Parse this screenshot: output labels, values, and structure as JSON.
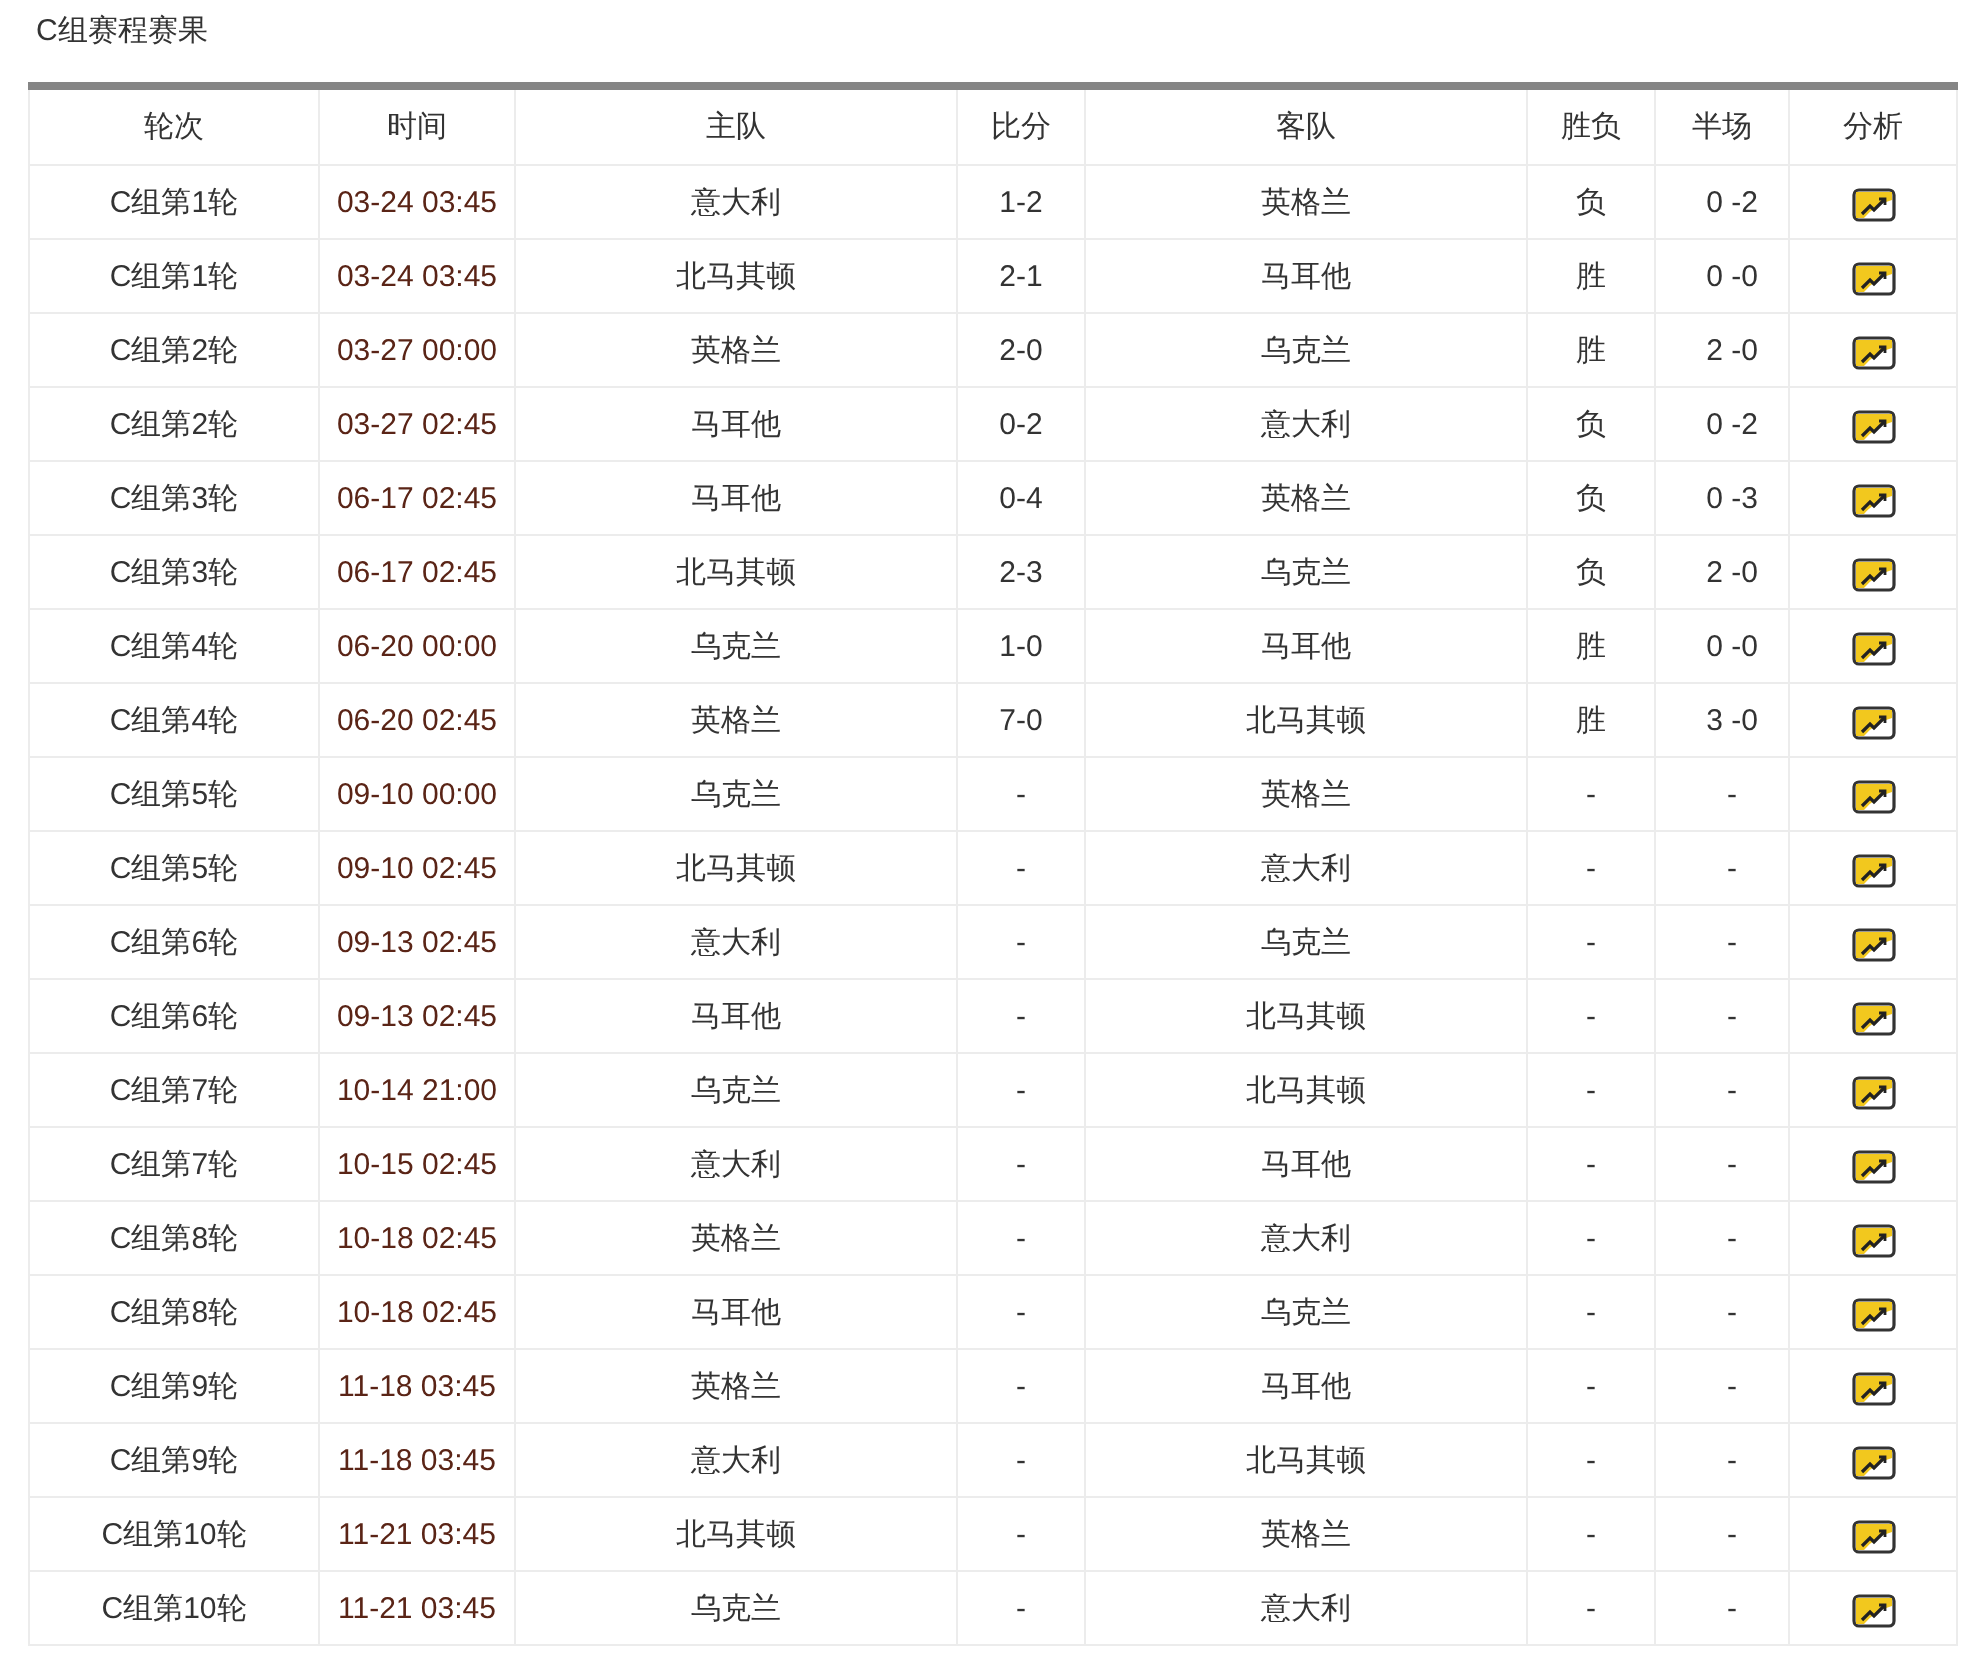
{
  "title": "C组赛程赛果",
  "table": {
    "columns": [
      "轮次",
      "时间",
      "主队",
      "比分",
      "客队",
      "胜负",
      "半场",
      "分析"
    ],
    "rows": [
      {
        "round": "C组第1轮",
        "time": "03-24 03:45",
        "home": "意大利",
        "score": "1-2",
        "away": "英格兰",
        "result": "负",
        "half": "0 -2"
      },
      {
        "round": "C组第1轮",
        "time": "03-24 03:45",
        "home": "北马其顿",
        "score": "2-1",
        "away": "马耳他",
        "result": "胜",
        "half": "0 -0"
      },
      {
        "round": "C组第2轮",
        "time": "03-27 00:00",
        "home": "英格兰",
        "score": "2-0",
        "away": "乌克兰",
        "result": "胜",
        "half": "2 -0"
      },
      {
        "round": "C组第2轮",
        "time": "03-27 02:45",
        "home": "马耳他",
        "score": "0-2",
        "away": "意大利",
        "result": "负",
        "half": "0 -2"
      },
      {
        "round": "C组第3轮",
        "time": "06-17 02:45",
        "home": "马耳他",
        "score": "0-4",
        "away": "英格兰",
        "result": "负",
        "half": "0 -3"
      },
      {
        "round": "C组第3轮",
        "time": "06-17 02:45",
        "home": "北马其顿",
        "score": "2-3",
        "away": "乌克兰",
        "result": "负",
        "half": "2 -0"
      },
      {
        "round": "C组第4轮",
        "time": "06-20 00:00",
        "home": "乌克兰",
        "score": "1-0",
        "away": "马耳他",
        "result": "胜",
        "half": "0 -0"
      },
      {
        "round": "C组第4轮",
        "time": "06-20 02:45",
        "home": "英格兰",
        "score": "7-0",
        "away": "北马其顿",
        "result": "胜",
        "half": "3 -0"
      },
      {
        "round": "C组第5轮",
        "time": "09-10 00:00",
        "home": "乌克兰",
        "score": "-",
        "away": "英格兰",
        "result": "-",
        "half": "-"
      },
      {
        "round": "C组第5轮",
        "time": "09-10 02:45",
        "home": "北马其顿",
        "score": "-",
        "away": "意大利",
        "result": "-",
        "half": "-"
      },
      {
        "round": "C组第6轮",
        "time": "09-13 02:45",
        "home": "意大利",
        "score": "-",
        "away": "乌克兰",
        "result": "-",
        "half": "-"
      },
      {
        "round": "C组第6轮",
        "time": "09-13 02:45",
        "home": "马耳他",
        "score": "-",
        "away": "北马其顿",
        "result": "-",
        "half": "-"
      },
      {
        "round": "C组第7轮",
        "time": "10-14 21:00",
        "home": "乌克兰",
        "score": "-",
        "away": "北马其顿",
        "result": "-",
        "half": "-"
      },
      {
        "round": "C组第7轮",
        "time": "10-15 02:45",
        "home": "意大利",
        "score": "-",
        "away": "马耳他",
        "result": "-",
        "half": "-"
      },
      {
        "round": "C组第8轮",
        "time": "10-18 02:45",
        "home": "英格兰",
        "score": "-",
        "away": "意大利",
        "result": "-",
        "half": "-"
      },
      {
        "round": "C组第8轮",
        "time": "10-18 02:45",
        "home": "马耳他",
        "score": "-",
        "away": "乌克兰",
        "result": "-",
        "half": "-"
      },
      {
        "round": "C组第9轮",
        "time": "11-18 03:45",
        "home": "英格兰",
        "score": "-",
        "away": "马耳他",
        "result": "-",
        "half": "-"
      },
      {
        "round": "C组第9轮",
        "time": "11-18 03:45",
        "home": "意大利",
        "score": "-",
        "away": "北马其顿",
        "result": "-",
        "half": "-"
      },
      {
        "round": "C组第10轮",
        "time": "11-21 03:45",
        "home": "北马其顿",
        "score": "-",
        "away": "英格兰",
        "result": "-",
        "half": "-"
      },
      {
        "round": "C组第10轮",
        "time": "11-21 03:45",
        "home": "乌克兰",
        "score": "-",
        "away": "意大利",
        "result": "-",
        "half": "-"
      }
    ]
  }
}
